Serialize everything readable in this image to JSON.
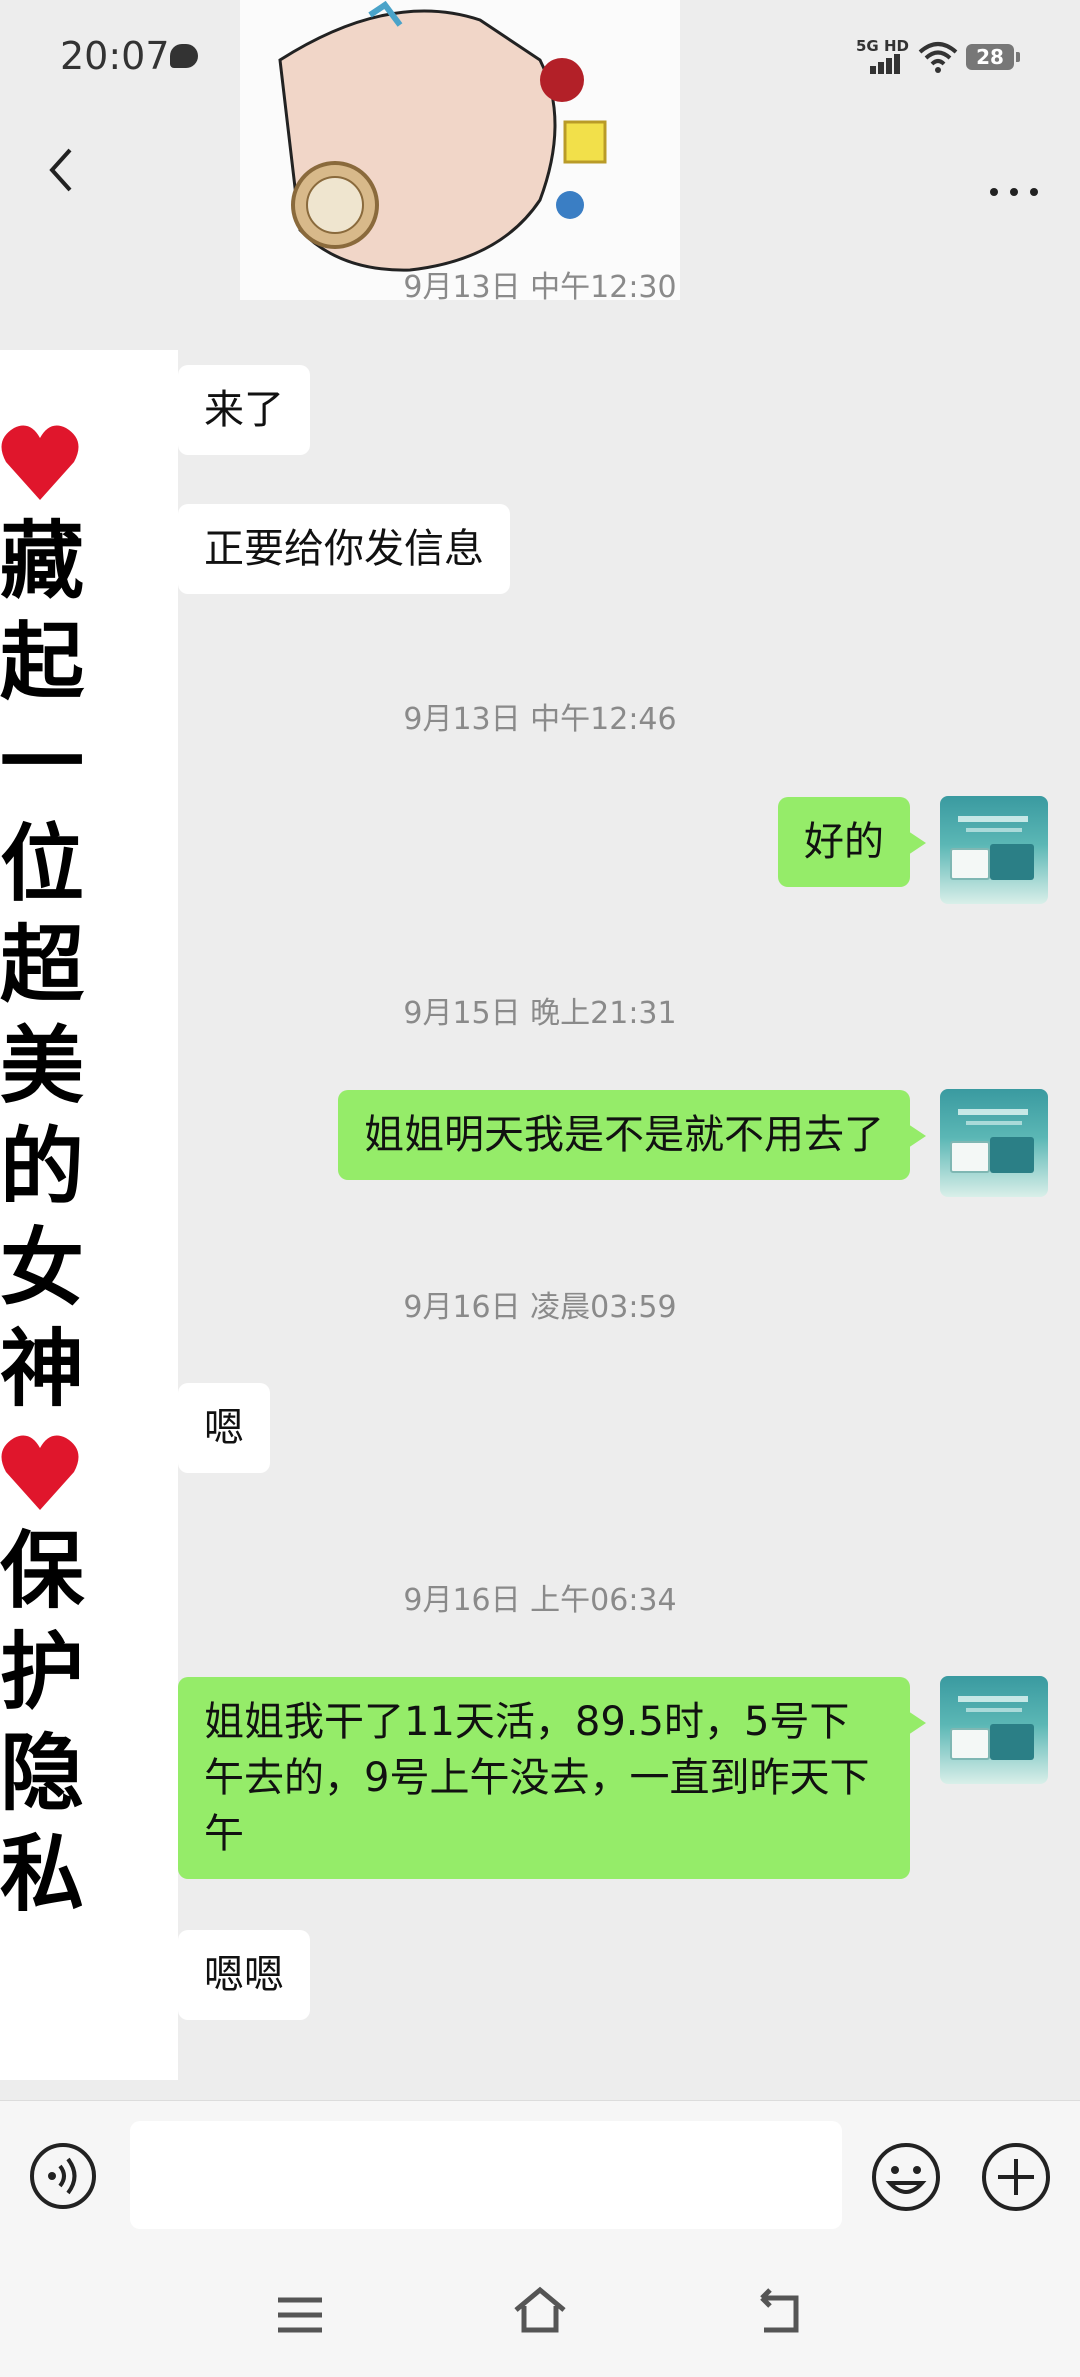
{
  "status_bar": {
    "time": "20:07",
    "network": "5G HD",
    "battery": "28"
  },
  "messages": [
    {
      "type": "timestamp",
      "text": "9月13日 中午12:30"
    },
    {
      "type": "in",
      "text": "来了"
    },
    {
      "type": "in",
      "text": "正要给你发信息"
    },
    {
      "type": "timestamp",
      "text": "9月13日 中午12:46"
    },
    {
      "type": "out",
      "text": "好的"
    },
    {
      "type": "timestamp",
      "text": "9月15日 晚上21:31"
    },
    {
      "type": "out",
      "text": "姐姐明天我是不是就不用去了"
    },
    {
      "type": "timestamp",
      "text": "9月16日 凌晨03:59"
    },
    {
      "type": "in",
      "text": "嗯"
    },
    {
      "type": "timestamp",
      "text": "9月16日 上午06:34"
    },
    {
      "type": "out",
      "text": "姐姐我干了11天活，89.5时，5号下午去的，9号上午没去，一直到昨天下午"
    },
    {
      "type": "in",
      "text": "嗯嗯"
    }
  ],
  "sticker_text": {
    "line1": "藏起一位超美的女神",
    "line2": "保护隐私"
  },
  "colors": {
    "background": "#ededed",
    "outgoing_bubble": "#95ec69",
    "incoming_bubble": "#ffffff"
  },
  "icons": {
    "back": "chevron-left-icon",
    "more": "more-dots-icon",
    "voice": "voice-icon",
    "emoji": "emoji-icon",
    "plus": "plus-icon"
  }
}
